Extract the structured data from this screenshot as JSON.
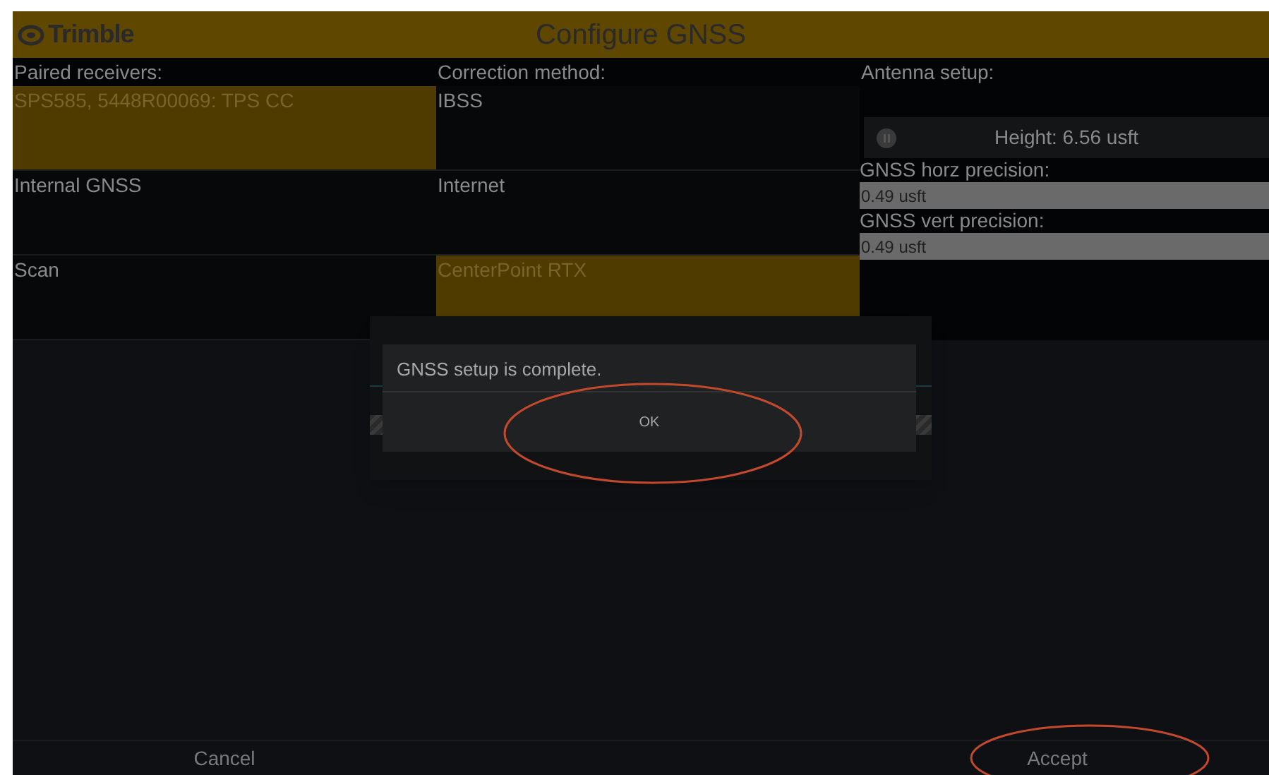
{
  "header": {
    "logo": "Trimble",
    "title": "Configure GNSS"
  },
  "receivers": {
    "label": "Paired receivers:",
    "items": [
      {
        "label": "SPS585, 5448R00069: TPS CC",
        "selected": true
      },
      {
        "label": "Internal GNSS",
        "selected": false
      },
      {
        "label": "Scan",
        "selected": false
      }
    ]
  },
  "correction": {
    "label": "Correction method:",
    "items": [
      {
        "label": "IBSS",
        "selected": false
      },
      {
        "label": "Internet",
        "selected": false
      },
      {
        "label": "CenterPoint RTX",
        "selected": true
      }
    ]
  },
  "antenna": {
    "label": "Antenna setup:",
    "height": "Height: 6.56 usft"
  },
  "precision": [
    {
      "label": "GNSS horz precision:",
      "value": "0.49 usft"
    },
    {
      "label": "GNSS vert precision:",
      "value": "0.49 usft"
    }
  ],
  "progress": {
    "indeterminate": true
  },
  "dialog": {
    "message": "GNSS setup is complete.",
    "button": "OK"
  },
  "footer": {
    "buttons": [
      "Cancel",
      "Accept"
    ]
  }
}
